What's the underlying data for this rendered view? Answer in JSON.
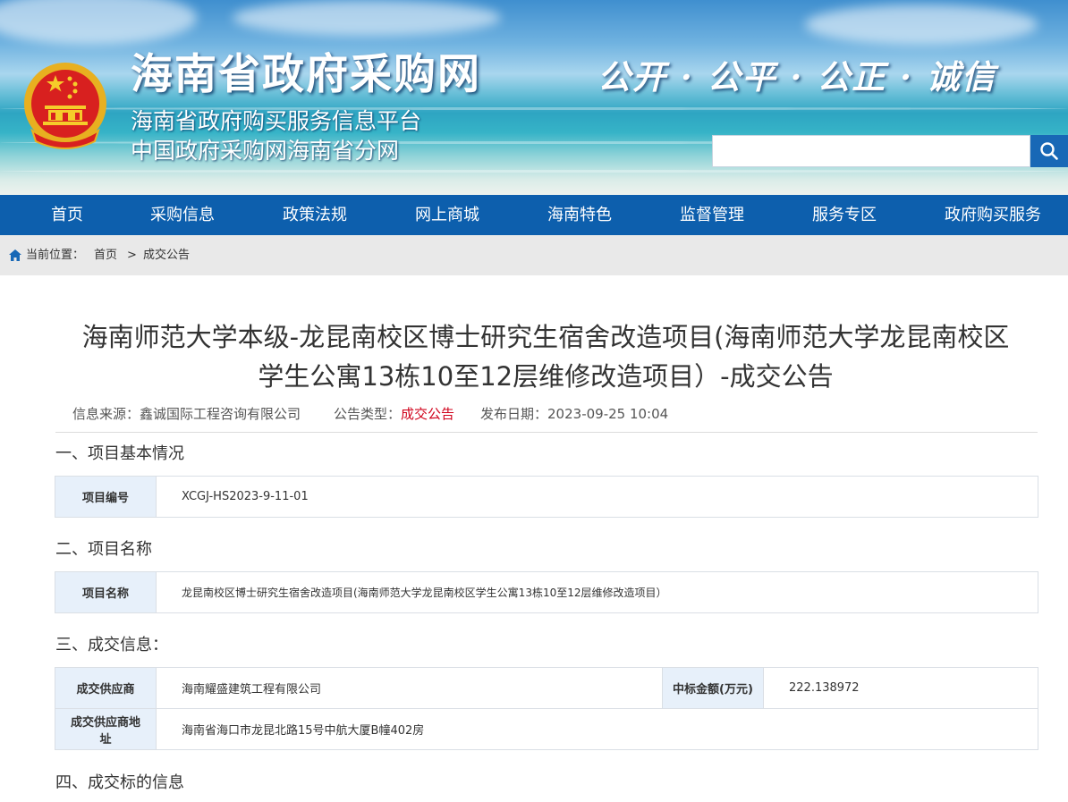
{
  "header": {
    "site_title": "海南省政府采购网",
    "subtitle_1": "海南省政府购买服务信息平台",
    "subtitle_2": "中国政府采购网海南省分网",
    "slogan": "公开 · 公平 · 公正 · 诚信",
    "search": {
      "value": "",
      "placeholder": ""
    }
  },
  "nav": {
    "items": [
      "首页",
      "采购信息",
      "政策法规",
      "网上商城",
      "海南特色",
      "监督管理",
      "服务专区",
      "政府购买服务"
    ]
  },
  "breadcrumb": {
    "prefix": "当前位置：",
    "home": "首页",
    "separator": ">",
    "current": "成交公告"
  },
  "article": {
    "title_line1": "海南师范大学本级-龙昆南校区博士研究生宿舍改造项目(海南师范大学龙昆南校区",
    "title_line2": "学生公寓13栋10至12层维修改造项目）-成交公告",
    "meta": {
      "source_label": "信息来源：",
      "source": "鑫诚国际工程咨询有限公司",
      "type_label": "公告类型：",
      "type": "成交公告",
      "date_label": "发布日期：",
      "date": "2023-09-25 10:04"
    },
    "sections": {
      "s1": "一、项目基本情况",
      "s2": "二、项目名称",
      "s3": "三、成交信息：",
      "s4": "四、成交标的信息"
    },
    "project_no": {
      "label": "项目编号",
      "value": "XCGJ-HS2023-9-11-01"
    },
    "project_name": {
      "label": "项目名称",
      "value": "龙昆南校区博士研究生宿舍改造项目(海南师范大学龙昆南校区学生公寓13栋10至12层维修改造项目）"
    },
    "deal": {
      "supplier_label": "成交供应商",
      "supplier": "海南耀盛建筑工程有限公司",
      "amount_label": "中标金额(万元)",
      "amount": "222.138972",
      "address_label": "成交供应商地址",
      "address": "海南省海口市龙昆北路15号中航大厦B幢402房"
    }
  },
  "colors": {
    "nav_bg": "#0d5fad",
    "search_btn": "#1868b6",
    "label_cell_bg": "#e7f0fa",
    "accent_red": "#d0021b",
    "breadcrumb_bg": "#e9e9e9"
  },
  "icons": [
    "emblem-icon",
    "search-icon",
    "home-icon"
  ]
}
